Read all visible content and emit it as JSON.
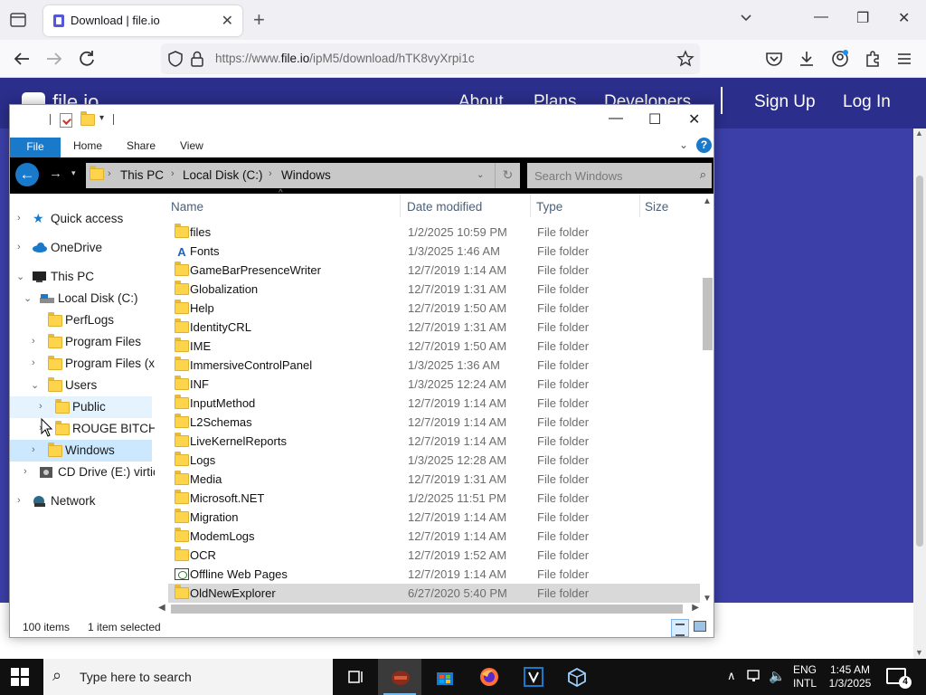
{
  "browser": {
    "tab_title": "Download | file.io",
    "new_tab": "+",
    "url_base": "https://www.",
    "url_host": "file.io",
    "url_path": "/ipM5/download/hTK8vyXrpi1c",
    "tab_close": "✕",
    "minimize": "—",
    "restore": "❐",
    "close": "✕"
  },
  "site": {
    "logo_text": "file.io",
    "nav": [
      "About",
      "Plans",
      "Developers",
      "Sign Up",
      "Log In"
    ]
  },
  "explorer": {
    "ribbon_tabs": {
      "file": "File",
      "home": "Home",
      "share": "Share",
      "view": "View"
    },
    "help": "?",
    "breadcrumb": [
      "This PC",
      "Local Disk (C:)",
      "Windows"
    ],
    "search_placeholder": "Search Windows",
    "columns": {
      "name": "Name",
      "date": "Date modified",
      "type": "Type",
      "size": "Size"
    },
    "tree": [
      {
        "label": "Quick access",
        "icon": "star-icon",
        "state": "collapsed"
      },
      {
        "label": "OneDrive",
        "icon": "cloud-icon",
        "state": "collapsed"
      },
      {
        "label": "This PC",
        "icon": "computer-icon",
        "state": "expanded"
      },
      {
        "label": "Local Disk (C:)",
        "icon": "drive-icon",
        "state": "expanded"
      },
      {
        "label": "PerfLogs",
        "icon": "folder-icon",
        "state": "none"
      },
      {
        "label": "Program Files",
        "icon": "folder-icon",
        "state": "collapsed"
      },
      {
        "label": "Program Files (x",
        "icon": "folder-icon",
        "state": "collapsed"
      },
      {
        "label": "Users",
        "icon": "folder-icon",
        "state": "expanded"
      },
      {
        "label": "Public",
        "icon": "folder-icon",
        "state": "collapsed"
      },
      {
        "label": "ROUGE BITCH",
        "icon": "folder-icon",
        "state": "collapsed"
      },
      {
        "label": "Windows",
        "icon": "folder-icon",
        "state": "collapsed"
      },
      {
        "label": "CD Drive (E:) virtio",
        "icon": "cd-drive-icon",
        "state": "collapsed"
      },
      {
        "label": "Network",
        "icon": "network-icon",
        "state": "collapsed"
      }
    ],
    "files": [
      {
        "name": "files",
        "date": "1/2/2025 10:59 PM",
        "type": "File folder",
        "icon": "folder-icon"
      },
      {
        "name": "Fonts",
        "date": "1/3/2025 1:46 AM",
        "type": "File folder",
        "icon": "fonts-folder-icon"
      },
      {
        "name": "GameBarPresenceWriter",
        "date": "12/7/2019 1:14 AM",
        "type": "File folder",
        "icon": "folder-icon"
      },
      {
        "name": "Globalization",
        "date": "12/7/2019 1:31 AM",
        "type": "File folder",
        "icon": "folder-icon"
      },
      {
        "name": "Help",
        "date": "12/7/2019 1:50 AM",
        "type": "File folder",
        "icon": "folder-icon"
      },
      {
        "name": "IdentityCRL",
        "date": "12/7/2019 1:31 AM",
        "type": "File folder",
        "icon": "folder-icon"
      },
      {
        "name": "IME",
        "date": "12/7/2019 1:50 AM",
        "type": "File folder",
        "icon": "folder-icon"
      },
      {
        "name": "ImmersiveControlPanel",
        "date": "1/3/2025 1:36 AM",
        "type": "File folder",
        "icon": "folder-icon"
      },
      {
        "name": "INF",
        "date": "1/3/2025 12:24 AM",
        "type": "File folder",
        "icon": "folder-icon"
      },
      {
        "name": "InputMethod",
        "date": "12/7/2019 1:14 AM",
        "type": "File folder",
        "icon": "folder-icon"
      },
      {
        "name": "L2Schemas",
        "date": "12/7/2019 1:14 AM",
        "type": "File folder",
        "icon": "folder-icon"
      },
      {
        "name": "LiveKernelReports",
        "date": "12/7/2019 1:14 AM",
        "type": "File folder",
        "icon": "folder-icon"
      },
      {
        "name": "Logs",
        "date": "1/3/2025 12:28 AM",
        "type": "File folder",
        "icon": "folder-icon"
      },
      {
        "name": "Media",
        "date": "12/7/2019 1:31 AM",
        "type": "File folder",
        "icon": "folder-icon"
      },
      {
        "name": "Microsoft.NET",
        "date": "1/2/2025 11:51 PM",
        "type": "File folder",
        "icon": "folder-icon"
      },
      {
        "name": "Migration",
        "date": "12/7/2019 1:14 AM",
        "type": "File folder",
        "icon": "folder-icon"
      },
      {
        "name": "ModemLogs",
        "date": "12/7/2019 1:14 AM",
        "type": "File folder",
        "icon": "folder-icon"
      },
      {
        "name": "OCR",
        "date": "12/7/2019 1:52 AM",
        "type": "File folder",
        "icon": "folder-icon"
      },
      {
        "name": "Offline Web Pages",
        "date": "12/7/2019 1:14 AM",
        "type": "File folder",
        "icon": "web-folder-icon"
      },
      {
        "name": "OldNewExplorer",
        "date": "6/27/2020 5:40 PM",
        "type": "File folder",
        "icon": "folder-icon"
      }
    ],
    "status": {
      "count": "100 items",
      "selected": "1 item selected"
    }
  },
  "taskbar": {
    "search_placeholder": "Type here to search",
    "lang_line1": "ENG",
    "lang_line2": "INTL",
    "time": "1:45 AM",
    "date": "1/3/2025",
    "notification_count": "4"
  },
  "colors": {
    "accent": "#1979ca",
    "site_background": "#3c3fa7",
    "selection": "#cce8ff"
  }
}
